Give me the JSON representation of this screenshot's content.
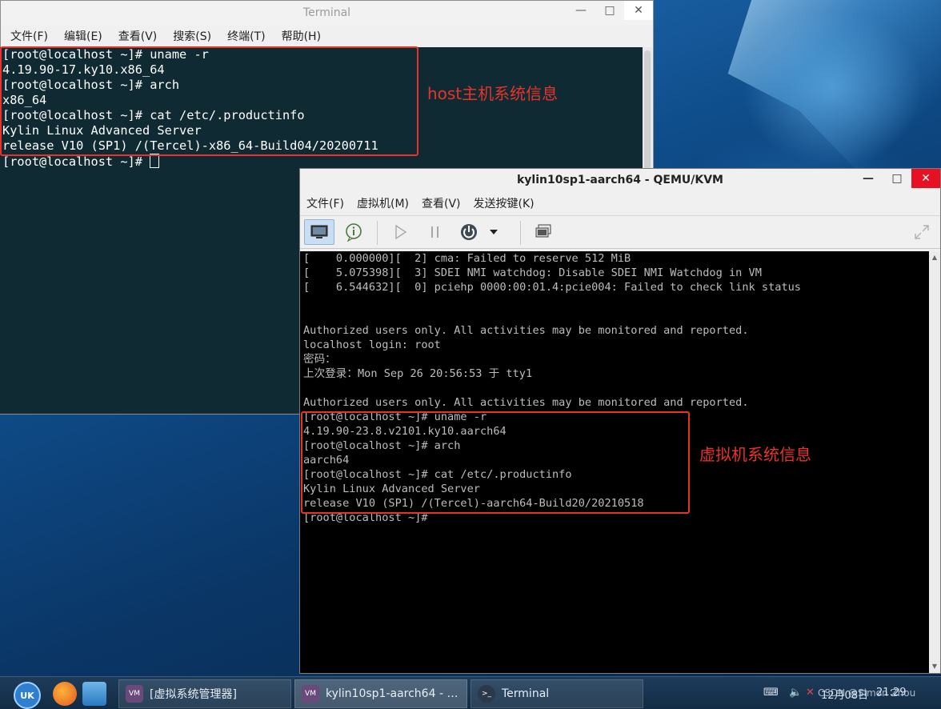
{
  "terminal": {
    "title": "Terminal",
    "menu": [
      "文件(F)",
      "编辑(E)",
      "查看(V)",
      "搜索(S)",
      "终端(T)",
      "帮助(H)"
    ],
    "lines": [
      "[root@localhost ~]# uname -r",
      "4.19.90-17.ky10.x86_64",
      "[root@localhost ~]# arch",
      "x86_64",
      "[root@localhost ~]# cat /etc/.productinfo",
      "Kylin Linux Advanced Server",
      "release V10 (SP1) /(Tercel)-x86_64-Build04/20200711",
      "[root@localhost ~]# "
    ],
    "annotation": "host主机系统信息"
  },
  "vm_window": {
    "title": "kylin10sp1-aarch64 - QEMU/KVM",
    "menu": [
      "文件(F)",
      "虚拟机(M)",
      "查看(V)",
      "发送按键(K)"
    ],
    "toolbar": [
      "monitor-icon",
      "info-icon",
      "play-icon",
      "pause-icon",
      "power-icon",
      "dropdown-icon",
      "snapshot-icon",
      "fullscreen-icon"
    ],
    "console_lines": [
      "[    0.000000][  2] cma: Failed to reserve 512 MiB",
      "[    5.075398][  3] SDEI NMI watchdog: Disable SDEI NMI Watchdog in VM",
      "[    6.544632][  0] pciehp 0000:00:01.4:pcie004: Failed to check link status",
      "",
      "",
      "Authorized users only. All activities may be monitored and reported.",
      "localhost login: root",
      "密码：",
      "上次登录：Mon Sep 26 20:56:53 于 tty1",
      "",
      "Authorized users only. All activities may be monitored and reported.",
      "[root@localhost ~]# uname -r",
      "4.19.90-23.8.v2101.ky10.aarch64",
      "[root@localhost ~]# arch",
      "aarch64",
      "[root@localhost ~]# cat /etc/.productinfo",
      "Kylin Linux Advanced Server",
      "release V10 (SP1) /(Tercel)-aarch64-Build20/20210518",
      "[root@localhost ~]#"
    ],
    "annotation": "虚拟机系统信息"
  },
  "taskbar": {
    "start_label": "UK",
    "tasks": [
      "[虚拟系统管理器]",
      "kylin10sp1-aarch64 - …",
      "Terminal"
    ],
    "tray_text": "CSDN @Simon Zhou",
    "clock": "21:29",
    "date": "12月08日"
  },
  "colors": {
    "annotation_red": "#e8332b",
    "terminal_bg": "#102a33",
    "vm_console_bg": "#000000"
  }
}
